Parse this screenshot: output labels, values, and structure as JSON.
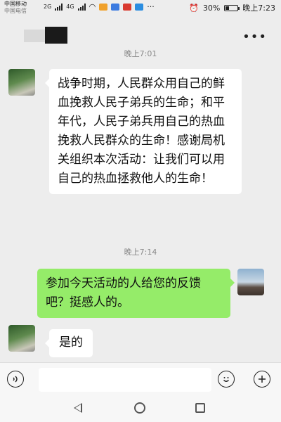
{
  "status_bar": {
    "carrier_1": "中国移动",
    "carrier_2": "中国电信",
    "network_1": "2G",
    "network_2": "4G",
    "battery": "30%",
    "time": "晚上7:23",
    "battery_level": 0.3
  },
  "chat": {
    "messages": [
      {
        "timestamp": "晚上7:01",
        "sender": "contact",
        "text": "战争时期，人民群众用自己的鲜血挽救人民子弟兵的生命；和平年代，人民子弟兵用自己的热血挽救人民群众的生命！感谢局机关组织本次活动：让我们可以用自己的热血拯救他人的生命！"
      },
      {
        "timestamp": "晚上7:14",
        "sender": "me",
        "text": "参加今天活动的人给您的反馈吧？挺感人的。"
      },
      {
        "sender": "contact",
        "text": "是的"
      }
    ]
  },
  "input_bar": {
    "voice_icon": "voice-icon",
    "emoji_icon": "emoji-icon",
    "more_icon": "plus-icon"
  },
  "colors": {
    "background": "#ededed",
    "outgoing_bubble": "#95ec69",
    "incoming_bubble": "#ffffff"
  }
}
